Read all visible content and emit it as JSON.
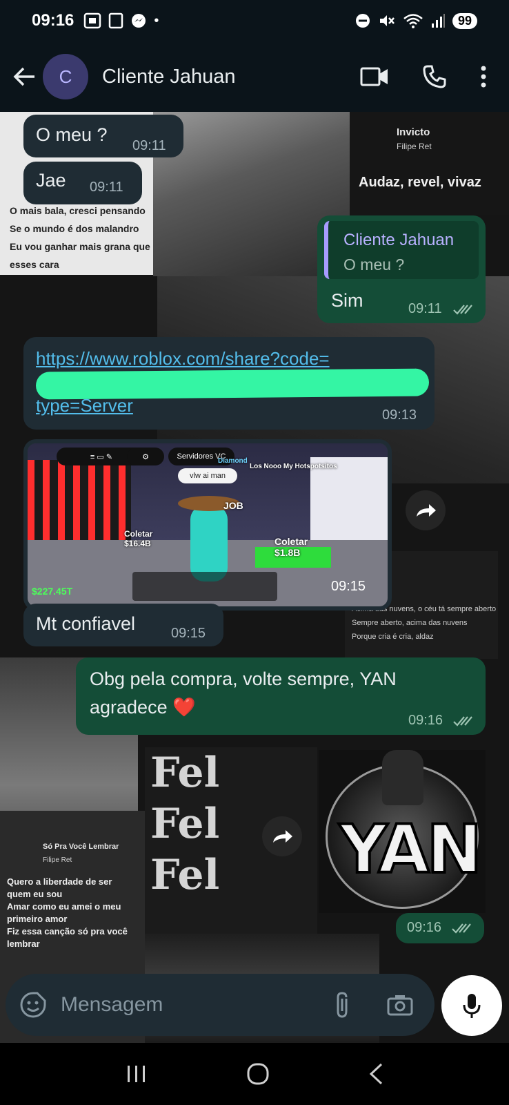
{
  "status": {
    "time": "09:16",
    "battery": "99",
    "dot": "•"
  },
  "header": {
    "avatar_letter": "C",
    "contact_name": "Cliente Jahuan"
  },
  "wallpaper": {
    "song1": {
      "title": "Invicto",
      "artist": "Filipe Ret",
      "lyric": "Audaz, revel, vivaz"
    },
    "lyrics_left": [
      "O mais bala, cresci pensando",
      "Se o mundo é dos malandro",
      "Eu vou ganhar mais grana que",
      "esses cara"
    ],
    "lyrics_right": [
      "Acima das nuvens, o céu tá sempre aberto",
      "Sempre aberto, acima das nuvens",
      "Porque cria é cria, aldaz"
    ],
    "song2": {
      "title": "Só Pra Você Lembrar",
      "artist": "Filipe Ret"
    },
    "lyrics_bottom": [
      "Quero a liberdade de ser",
      "quem eu sou",
      "Amar como eu amei o meu",
      "primeiro amor",
      "Fiz essa canção só pra você",
      "lembrar"
    ],
    "felipe_text": "Fel"
  },
  "messages": [
    {
      "id": "m1",
      "dir": "in",
      "text": "O meu ?",
      "time": "09:11"
    },
    {
      "id": "m2",
      "dir": "in",
      "text": "Jae",
      "time": "09:11"
    },
    {
      "id": "m3",
      "dir": "out",
      "quote_name": "Cliente Jahuan",
      "quote_text": "O meu ?",
      "text": "Sim",
      "time": "09:11"
    },
    {
      "id": "m4",
      "dir": "in",
      "link_line1": "https://www.roblox.com/share?code=",
      "link_line3": "type=Server",
      "time": "09:13"
    },
    {
      "id": "m5",
      "dir": "in",
      "type": "image",
      "time": "09:15"
    },
    {
      "id": "m6",
      "dir": "in",
      "text": "Mt confiavel",
      "time": "09:15"
    },
    {
      "id": "m7",
      "dir": "out",
      "text_line1": "Obg pela compra, volte sempre, YAN",
      "text_line2": "agradece",
      "emoji": "❤️",
      "time": "09:16"
    },
    {
      "id": "m8",
      "dir": "out",
      "type": "sticker",
      "sticker_text": "YAN",
      "time": "09:16"
    }
  ],
  "game": {
    "server_label": "Servidores VC",
    "chat_bubble": "vlw ai man",
    "collect1": "Coletar",
    "collect1_value": "$16.4B",
    "collect2": "Coletar",
    "collect2_value": "$1.8B",
    "money": "$227.45T",
    "job": "JOB",
    "title_right": "Los Nooo My Hotspotsitos",
    "diamond": "Diamond"
  },
  "input": {
    "placeholder": "Mensagem"
  },
  "colors": {
    "incoming": "#1f2c34",
    "outgoing": "#144d37",
    "link": "#53bdeb",
    "scribble": "#34f5a4"
  }
}
